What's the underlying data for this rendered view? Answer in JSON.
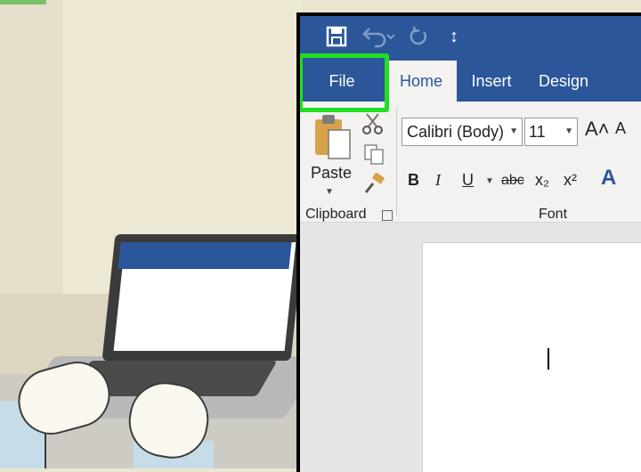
{
  "word": {
    "quick_access": {
      "save_icon": "save-icon",
      "undo_icon": "undo-icon",
      "redo_icon": "redo-icon",
      "customize_glyph": "↕"
    },
    "tabs": {
      "file": "File",
      "home": "Home",
      "insert": "Insert",
      "design": "Design"
    },
    "clipboard": {
      "paste_label": "Paste",
      "group_label": "Clipboard"
    },
    "font": {
      "font_name": "Calibri (Body)",
      "font_size": "11",
      "grow_glyph": "A˄",
      "shrink_glyph": "A",
      "bold": "B",
      "italic": "I",
      "underline": "U",
      "strikethrough": "abc",
      "subscript": "x₂",
      "superscript": "x²",
      "text_effects": "A",
      "group_label": "Font"
    }
  },
  "colors": {
    "ribbon_blue": "#2b579a",
    "highlight_green": "#22dd22"
  }
}
